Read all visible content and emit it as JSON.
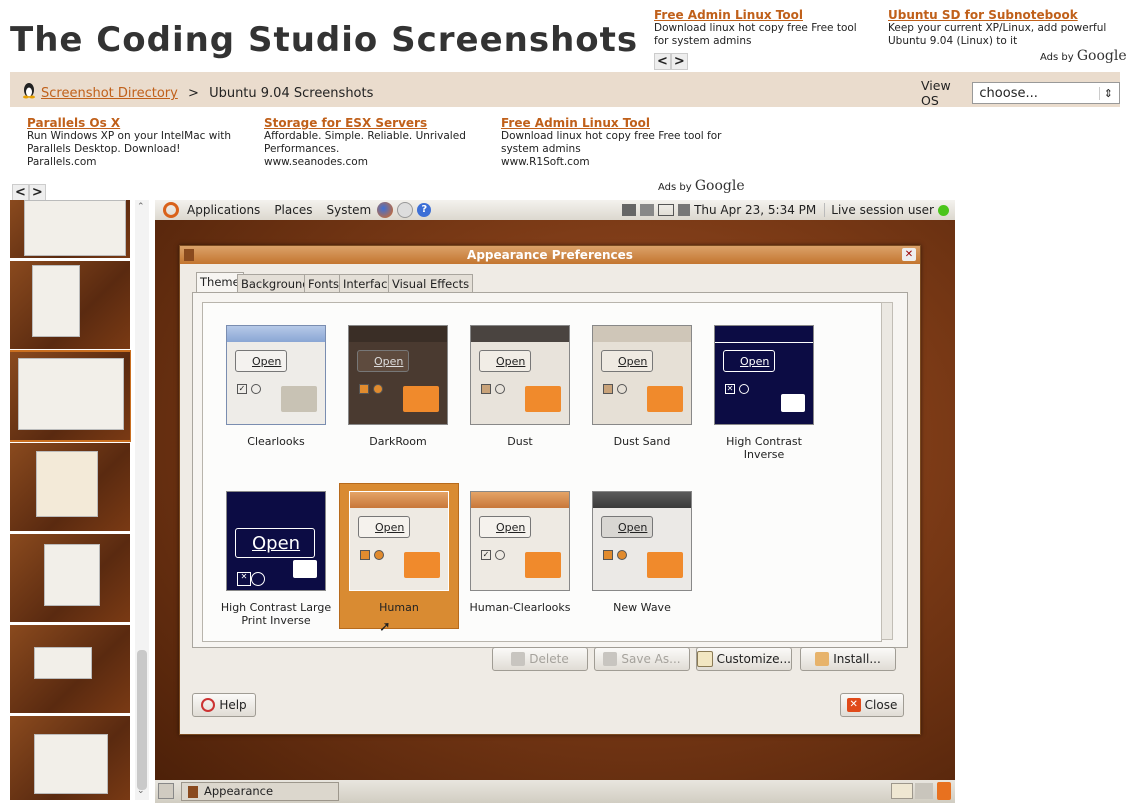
{
  "site": {
    "title": "The Coding Studio Screenshots"
  },
  "top_ads": [
    {
      "title": "Free Admin Linux Tool",
      "body": "Download linux hot copy free Free tool for system admins"
    },
    {
      "title": "Ubuntu SD for Subnotebook",
      "body": "Keep your current XP/Linux, add powerful Ubuntu 9.04 (Linux) to it"
    }
  ],
  "ads_nav": {
    "prev": "<",
    "next": ">"
  },
  "ads_by": {
    "prefix": "Ads by",
    "brand": "Google"
  },
  "breadcrumb": {
    "link": "Screenshot Directory",
    "separator": ">",
    "current": "Ubuntu 9.04 Screenshots"
  },
  "view_os": {
    "label": "View OS",
    "selected": "choose...",
    "arrow": "⇕"
  },
  "mid_ads": [
    {
      "title": "Parallels Os X",
      "body": "Run Windows XP on your IntelMac with Parallels Desktop. Download!",
      "url": "Parallels.com"
    },
    {
      "title": "Storage for ESX Servers",
      "body": "Affordable. Simple. Reliable. Unrivaled Performances.",
      "url": "www.seanodes.com"
    },
    {
      "title": "Free Admin Linux Tool",
      "body": "Download linux hot copy free Free tool for system admins",
      "url": "www.R1Soft.com"
    }
  ],
  "desktop": {
    "panel": {
      "menus": [
        "Applications",
        "Places",
        "System"
      ],
      "clock": "Thu Apr 23,  5:34 PM",
      "user": "Live session user"
    },
    "taskbar": {
      "item": "Appearance Preferences"
    }
  },
  "dialog": {
    "title": "Appearance Preferences",
    "tabs": [
      "Theme",
      "Background",
      "Fonts",
      "Interface",
      "Visual Effects"
    ],
    "active_tab": "Theme",
    "themes": [
      {
        "name": "Clearlooks",
        "open": "Open"
      },
      {
        "name": "DarkRoom",
        "open": "Open"
      },
      {
        "name": "Dust",
        "open": "Open"
      },
      {
        "name": "Dust Sand",
        "open": "Open"
      },
      {
        "name": "High Contrast Inverse",
        "open": "Open"
      },
      {
        "name": "High Contrast Large Print Inverse",
        "open": "Open"
      },
      {
        "name": "Human",
        "open": "Open"
      },
      {
        "name": "Human-Clearlooks",
        "open": "Open"
      },
      {
        "name": "New Wave",
        "open": "Open"
      }
    ],
    "selected_theme": "Human",
    "buttons": {
      "delete": "Delete",
      "save_as": "Save As...",
      "customize": "Customize...",
      "install": "Install...",
      "help": "Help",
      "close": "Close"
    }
  },
  "colors": {
    "accent": "#c0601a",
    "breadcrumb_bg": "#eadccd",
    "ubuntu_orange": "#d98b32"
  }
}
